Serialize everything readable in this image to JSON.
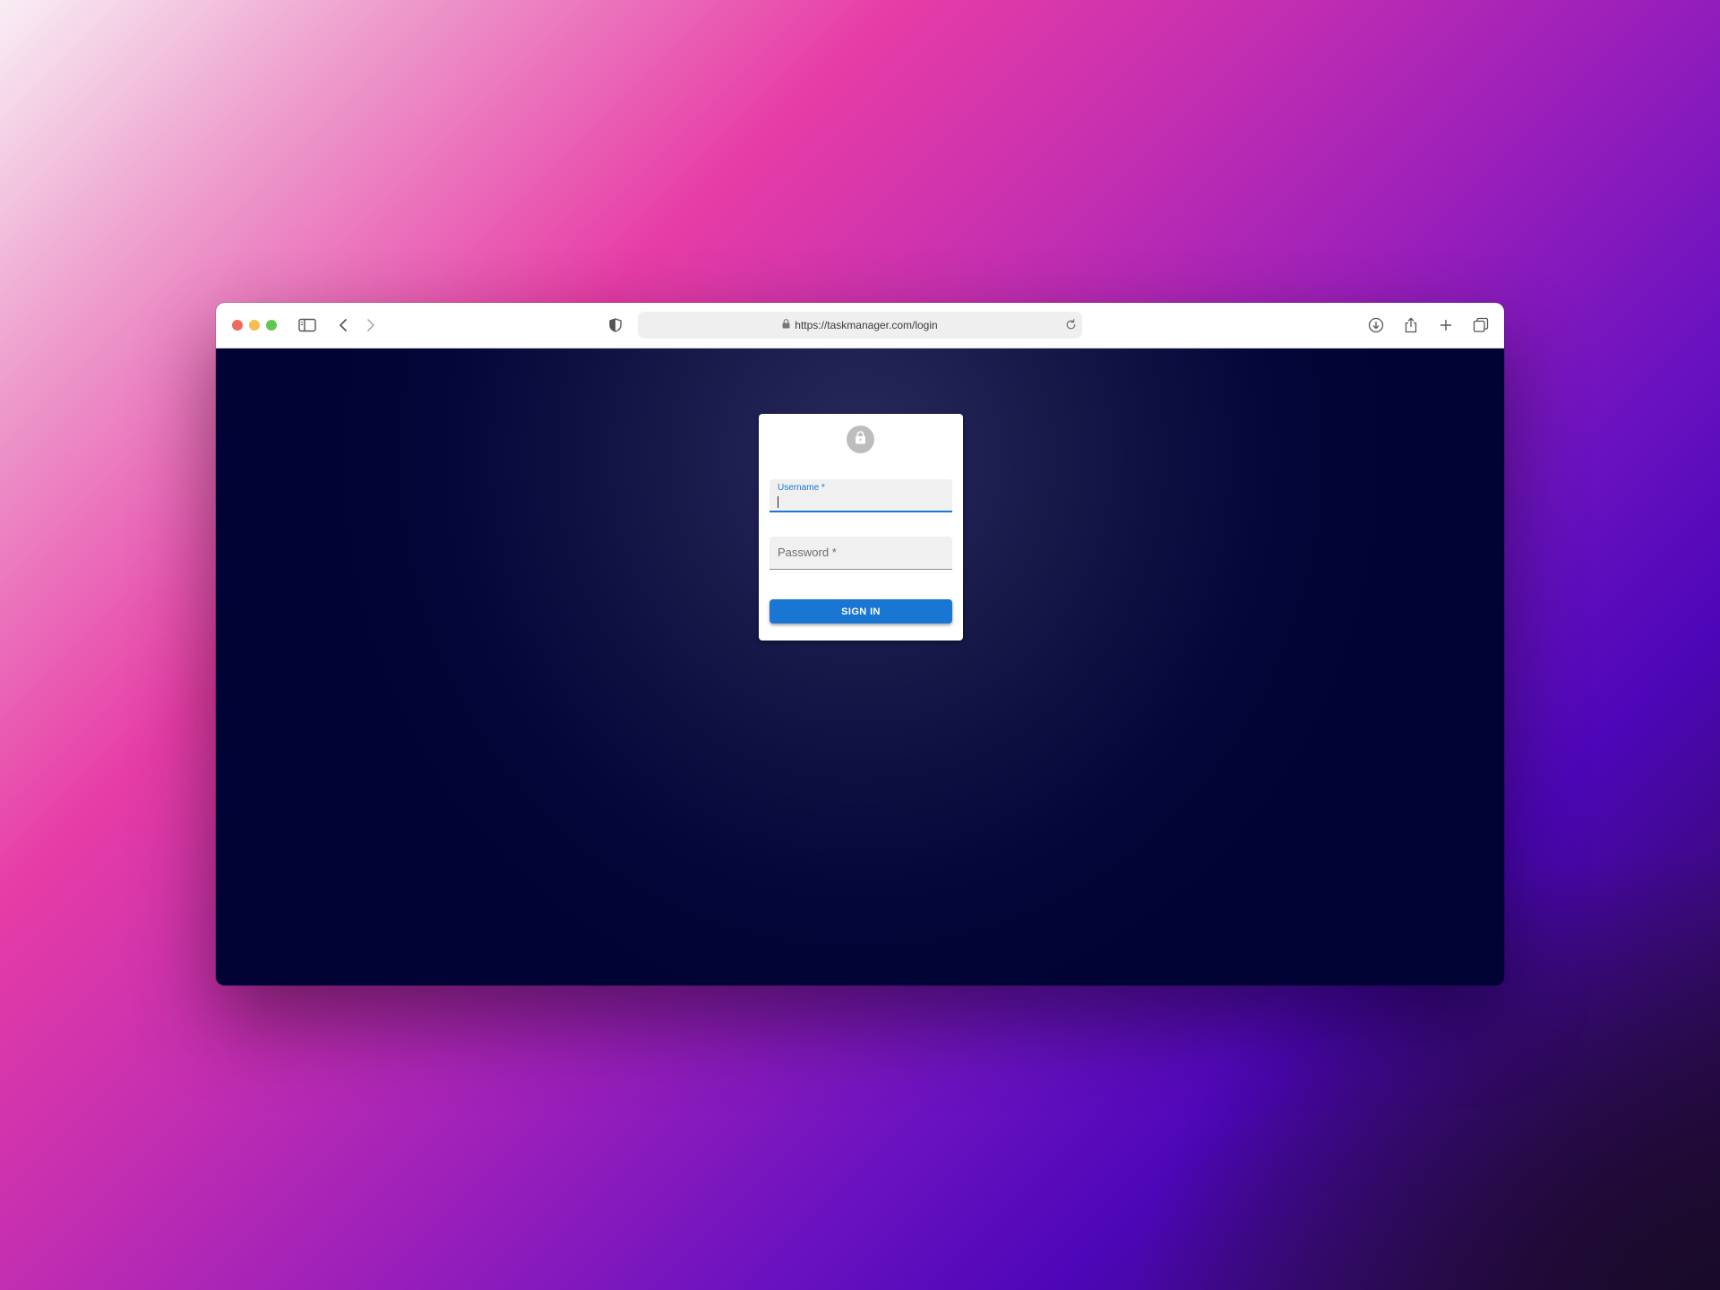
{
  "browser": {
    "url": "https://taskmanager.com/login",
    "toolbar_icons": {
      "sidebar": "sidebar-icon",
      "back": "chevron-left-icon",
      "forward": "chevron-right-icon",
      "privacy": "shield-icon",
      "lock": "lock-icon",
      "reload": "reload-icon",
      "downloads": "download-icon",
      "share": "share-icon",
      "new_tab": "plus-icon",
      "tabs": "tabs-overview-icon"
    }
  },
  "login": {
    "avatar_icon": "lock-icon",
    "username_label": "Username *",
    "username_value": "",
    "password_label": "Password *",
    "password_value": "",
    "submit_label": "SIGN IN"
  },
  "colors": {
    "primary": "#1976d2",
    "page_background": "#000333",
    "avatar": "#bdbdbd"
  }
}
